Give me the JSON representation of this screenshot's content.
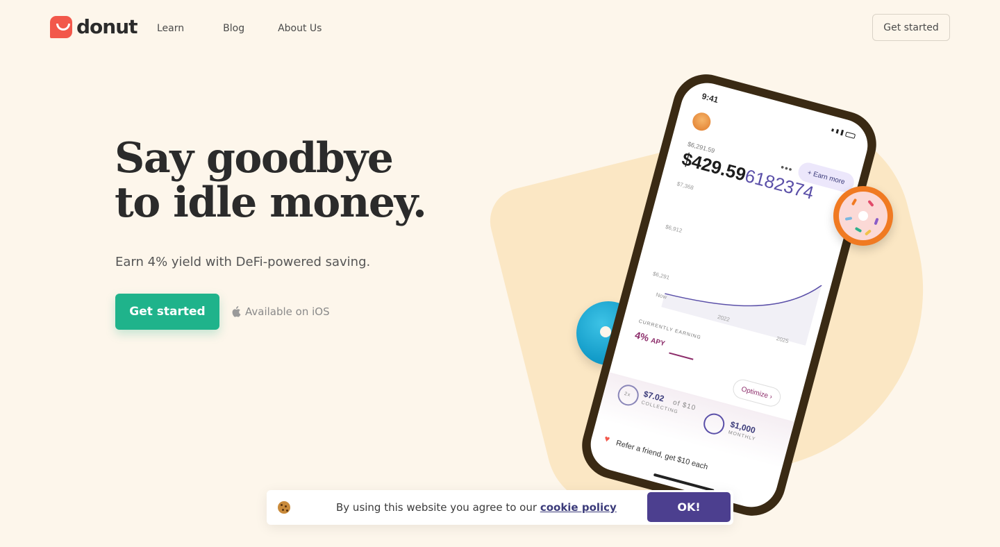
{
  "header": {
    "logo_text": "donut",
    "nav": [
      "Learn",
      "Blog",
      "About Us"
    ],
    "cta": "Get started"
  },
  "hero": {
    "title_line1": "Say goodbye",
    "title_line2": "to idle money.",
    "subtitle": "Earn 4% yield with DeFi-powered saving.",
    "cta": "Get started",
    "ios": "Available on iOS"
  },
  "phone": {
    "time": "9:41",
    "small_balance": "$6,291.59",
    "earn_more": "+ Earn more",
    "balance_main": "$429.59",
    "balance_frac": "6182374",
    "axis_values": [
      "$7,368",
      "$6,912",
      "$6,291"
    ],
    "x_labels": [
      "Now",
      "2022",
      "2025"
    ],
    "currently_earning": "CURRENTLY EARNING",
    "apy_value": "4%",
    "apy_label": "APY",
    "optimize": "Optimize ›",
    "collect_badge": "2x",
    "collect_amount": "$7.02",
    "collect_of": "of $10",
    "collect_sub": "COLLECTING",
    "monthly_amount": "$1,000",
    "monthly_sub": "MONTHLY",
    "refer": "Refer a friend, get $10 each"
  },
  "cookie": {
    "text": "By using this website you agree to our",
    "link": "cookie policy",
    "ok": "OK!"
  },
  "colors": {
    "background": "#fdf6eb",
    "primary_green": "#1fb38b",
    "brand_red": "#f2584b",
    "cookie_button": "#4c3f8f"
  }
}
